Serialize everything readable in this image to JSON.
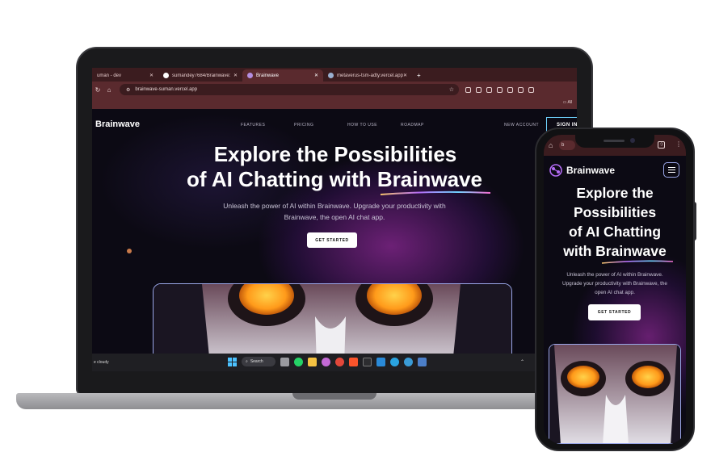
{
  "browser": {
    "tabs": [
      {
        "label": "uman - dev"
      },
      {
        "label": "sumandey7684/Brainwave: Sha"
      },
      {
        "label": "Brainwave"
      },
      {
        "label": "metaverus-tsm-adty.vercel.app"
      }
    ],
    "new_tab": "+",
    "url": "brainwave-suman.vercel.app",
    "bookmarks_label": "All"
  },
  "site": {
    "brand": "Brainwave",
    "nav": [
      "FEATURES",
      "PRICING",
      "HOW TO USE",
      "ROADMAP"
    ],
    "new_account": "NEW ACCOUNT",
    "sign_in": "SIGN IN",
    "hero_line1": "Explore the Possibilities",
    "hero_line2_prefix": "of AI Chatting with ",
    "hero_highlight": "Brainwave",
    "subtitle_line1": "Unleash the power of AI within Brainwave. Upgrade your productivity with",
    "subtitle_line2": "Brainwave, the open AI chat app.",
    "cta": "GET STARTED"
  },
  "taskbar": {
    "weather": "e cloudy",
    "search": "Search"
  },
  "phone": {
    "brand": "Brainwave",
    "url_short": "b",
    "tab_count": ":)",
    "title_lines": [
      "Explore the",
      "Possibilities",
      "of AI Chatting",
      "with "
    ],
    "title_highlight": "Brainwave",
    "subtitle_lines": [
      "Unleash the power of AI within Brainwave.",
      "Upgrade your productivity with Brainwave, the",
      "open AI chat app."
    ],
    "cta": "GET STARTED"
  },
  "colors": {
    "browser_chrome": "#3b1c1f",
    "site_bg": "#0c0a14",
    "accent_glow": "#8c2896",
    "highlight_gradient": [
      "#f7c56b",
      "#b46cf5",
      "#6fd3ff",
      "#f56cd1"
    ]
  }
}
